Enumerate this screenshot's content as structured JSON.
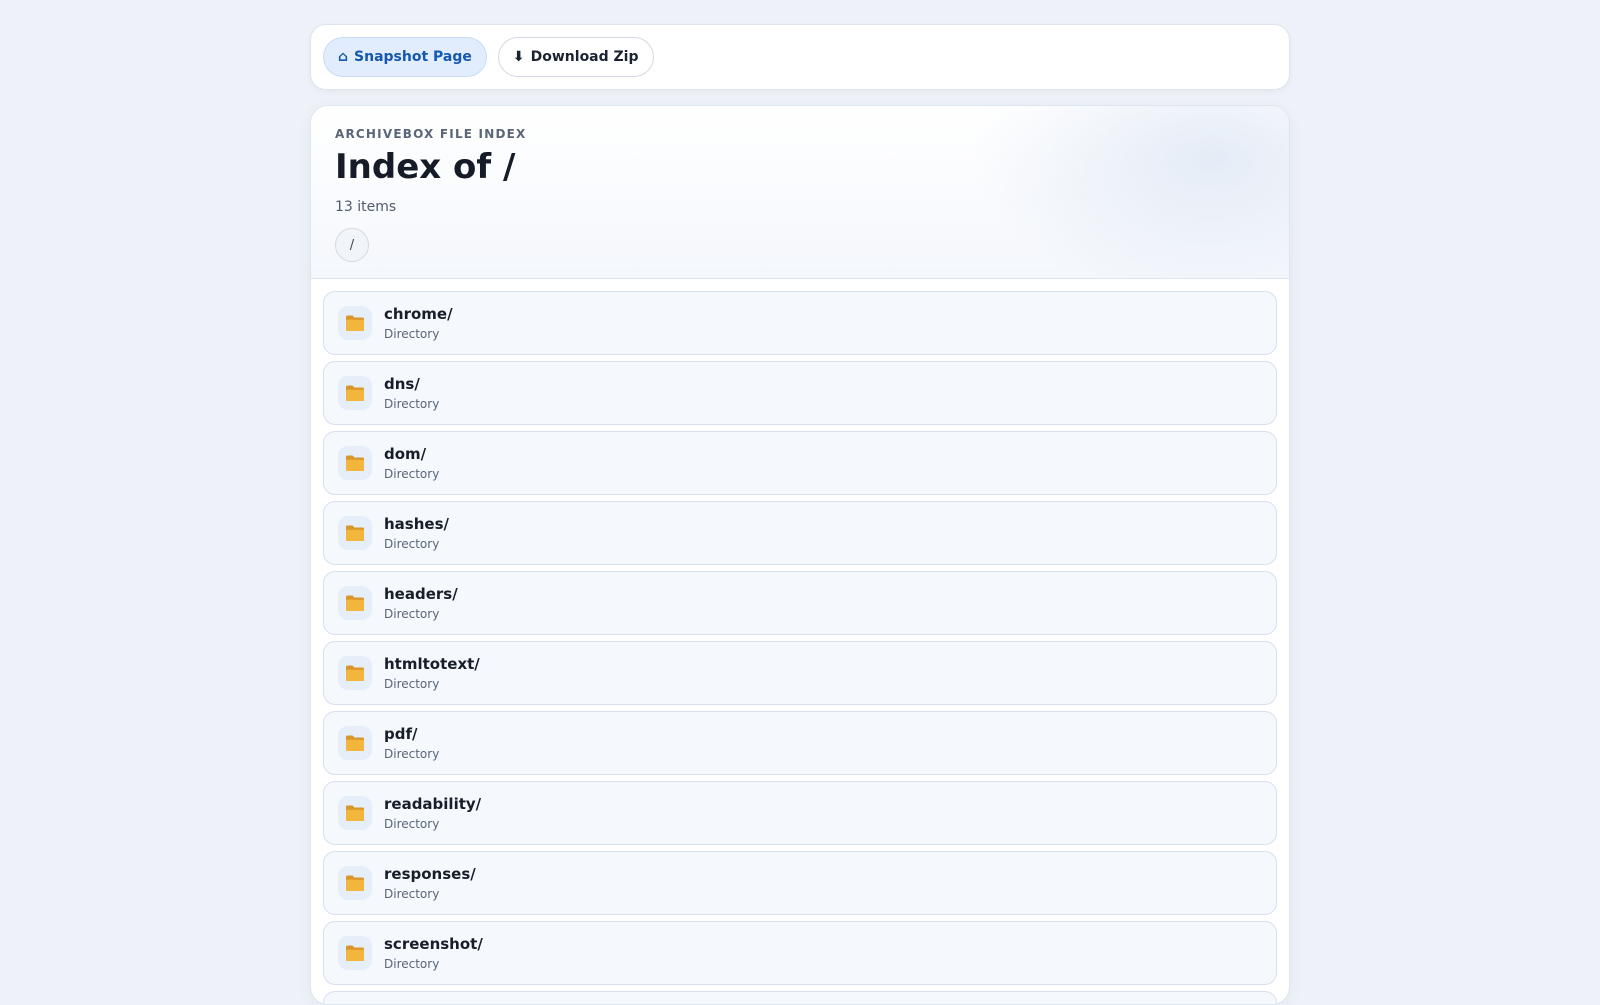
{
  "toolbar": {
    "snapshot_icon": "⌂",
    "snapshot_label": "Snapshot Page",
    "download_icon": "⬇",
    "download_label": "Download Zip"
  },
  "header": {
    "kicker": "ARCHIVEBOX FILE INDEX",
    "title": "Index of /",
    "count": "13 items",
    "breadcrumb": "/"
  },
  "entries": [
    {
      "name": "chrome/",
      "type": "Directory",
      "icon": "folder-icon"
    },
    {
      "name": "dns/",
      "type": "Directory",
      "icon": "folder-icon"
    },
    {
      "name": "dom/",
      "type": "Directory",
      "icon": "folder-icon"
    },
    {
      "name": "hashes/",
      "type": "Directory",
      "icon": "folder-icon"
    },
    {
      "name": "headers/",
      "type": "Directory",
      "icon": "folder-icon"
    },
    {
      "name": "htmltotext/",
      "type": "Directory",
      "icon": "folder-icon"
    },
    {
      "name": "pdf/",
      "type": "Directory",
      "icon": "folder-icon"
    },
    {
      "name": "readability/",
      "type": "Directory",
      "icon": "folder-icon"
    },
    {
      "name": "responses/",
      "type": "Directory",
      "icon": "folder-icon"
    },
    {
      "name": "screenshot/",
      "type": "Directory",
      "icon": "folder-icon"
    },
    {
      "name": "",
      "type": "",
      "icon": "folder-icon"
    }
  ],
  "colors": {
    "accent": "#1558b0",
    "page_bg": "#eef2f8",
    "row_bg": "#f5f8fd",
    "folder": "#f2b63d"
  }
}
